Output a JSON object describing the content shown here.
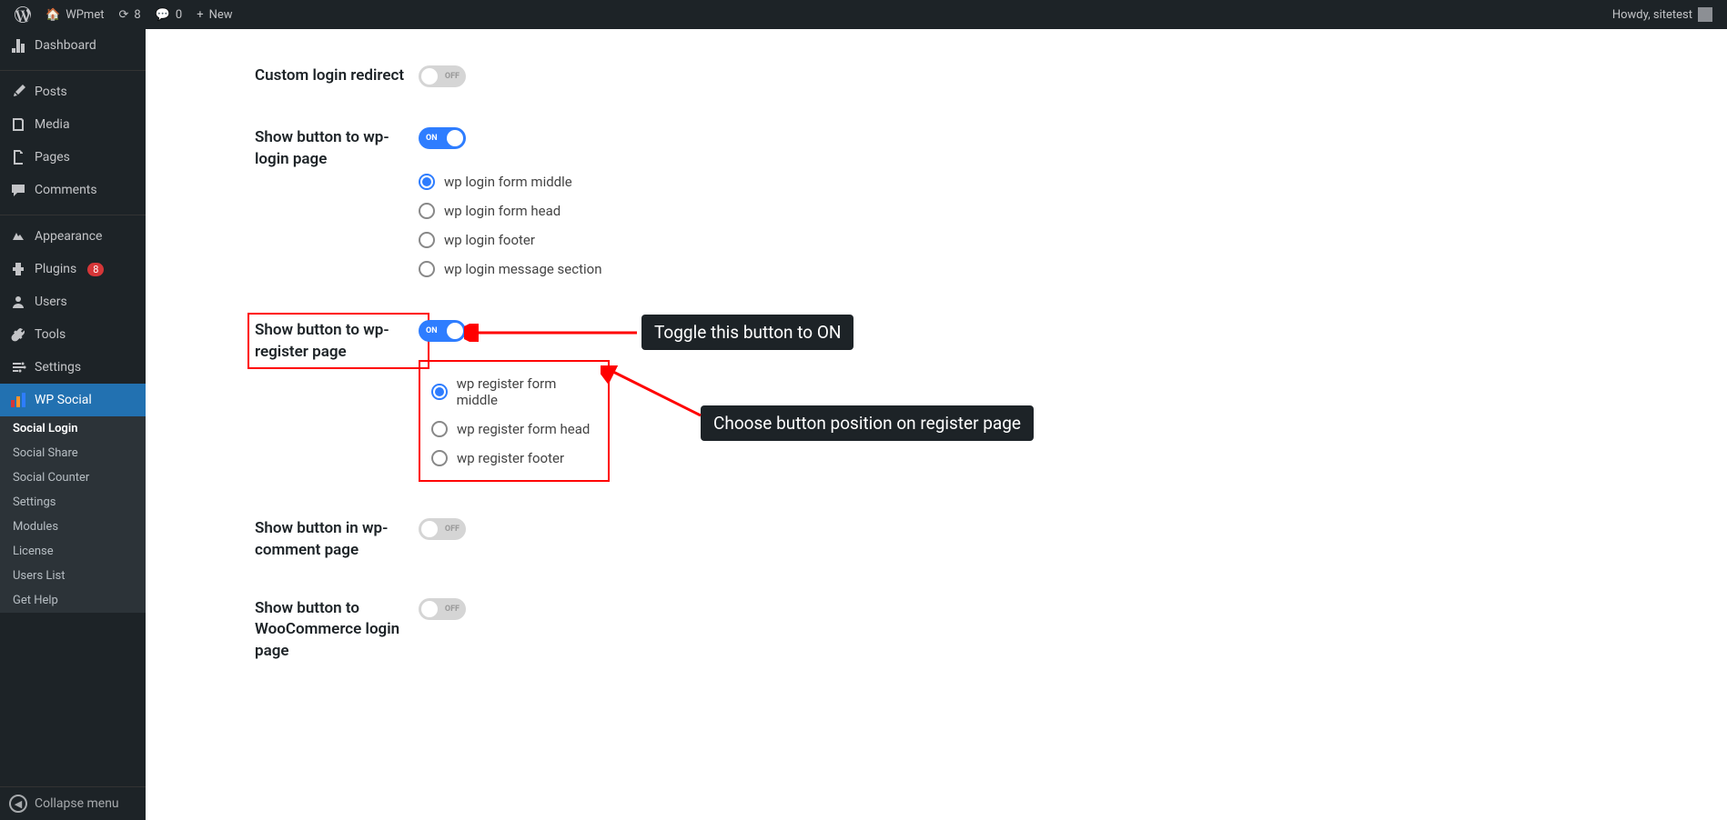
{
  "adminBar": {
    "siteName": "WPmet",
    "updateCount": "8",
    "commentCount": "0",
    "newLabel": "New",
    "howdy": "Howdy, sitetest"
  },
  "sidebar": {
    "items": [
      {
        "id": "dashboard",
        "label": "Dashboard",
        "icon": "⌂"
      },
      {
        "id": "posts",
        "label": "Posts",
        "icon": "📌"
      },
      {
        "id": "media",
        "label": "Media",
        "icon": "🖼"
      },
      {
        "id": "pages",
        "label": "Pages",
        "icon": "📄"
      },
      {
        "id": "comments",
        "label": "Comments",
        "icon": "💬"
      },
      {
        "id": "appearance",
        "label": "Appearance",
        "icon": "🖌"
      },
      {
        "id": "plugins",
        "label": "Plugins",
        "icon": "🔌",
        "badge": "8"
      },
      {
        "id": "users",
        "label": "Users",
        "icon": "👤"
      },
      {
        "id": "tools",
        "label": "Tools",
        "icon": "🔧"
      },
      {
        "id": "settings",
        "label": "Settings",
        "icon": "⚙"
      },
      {
        "id": "wpsocial",
        "label": "WP Social",
        "icon": "bars",
        "active": true
      }
    ],
    "submenu": [
      {
        "label": "Social Login",
        "current": true
      },
      {
        "label": "Social Share"
      },
      {
        "label": "Social Counter"
      },
      {
        "label": "Settings"
      },
      {
        "label": "Modules"
      },
      {
        "label": "License"
      },
      {
        "label": "Users List"
      },
      {
        "label": "Get Help"
      }
    ],
    "collapseLabel": "Collapse menu"
  },
  "settings": [
    {
      "id": "customLogin",
      "label": "Custom login redirect",
      "toggle": "off"
    },
    {
      "id": "wpLogin",
      "label": "Show button to wp-login page",
      "toggle": "on",
      "options": [
        {
          "label": "wp login form middle",
          "checked": true
        },
        {
          "label": "wp login form head"
        },
        {
          "label": "wp login footer"
        },
        {
          "label": "wp login message section"
        }
      ]
    },
    {
      "id": "wpRegister",
      "label": "Show button to wp-register page",
      "toggle": "on",
      "highlighted": true,
      "options": [
        {
          "label": "wp register form middle",
          "checked": true
        },
        {
          "label": "wp register form head"
        },
        {
          "label": "wp register footer"
        }
      ]
    },
    {
      "id": "wpComment",
      "label": "Show button in wp-comment page",
      "toggle": "off"
    },
    {
      "id": "woo",
      "label": "Show button to WooCommerce login page",
      "toggle": "off"
    }
  ],
  "annotations": {
    "toggleText": "Toggle this button to ON",
    "positionText": "Choose button position on register page"
  },
  "toggleLabels": {
    "on": "ON",
    "off": "OFF"
  }
}
